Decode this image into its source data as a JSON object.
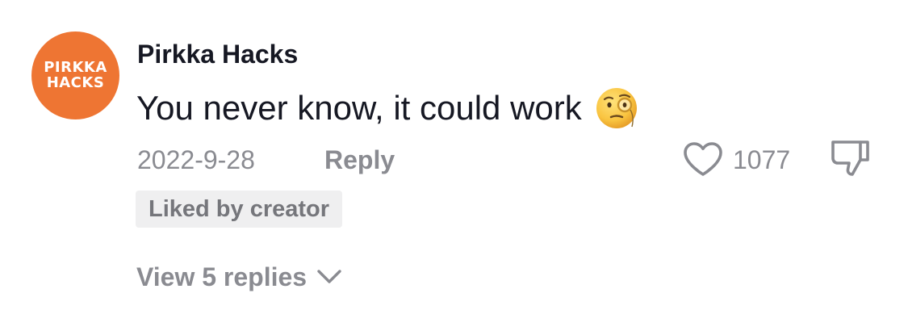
{
  "comment": {
    "avatar": {
      "line1": "PIRKKA",
      "line2": "HACKS",
      "background_color": "#EE7533"
    },
    "username": "Pirkka Hacks",
    "text": "You never know, it could work",
    "emoji": "face-with-monocle-emoji",
    "date": "2022-9-28",
    "reply_label": "Reply",
    "like_count": "1077",
    "like_icon": "heart-outline-icon",
    "dislike_icon": "thumbs-down-icon",
    "creator_badge": "Liked by creator",
    "view_replies_label": "View 5 replies",
    "view_replies_icon": "chevron-down-icon"
  },
  "colors": {
    "text_primary": "#161823",
    "text_secondary": "#8A8B91",
    "badge_bg": "#EFEFF0"
  }
}
